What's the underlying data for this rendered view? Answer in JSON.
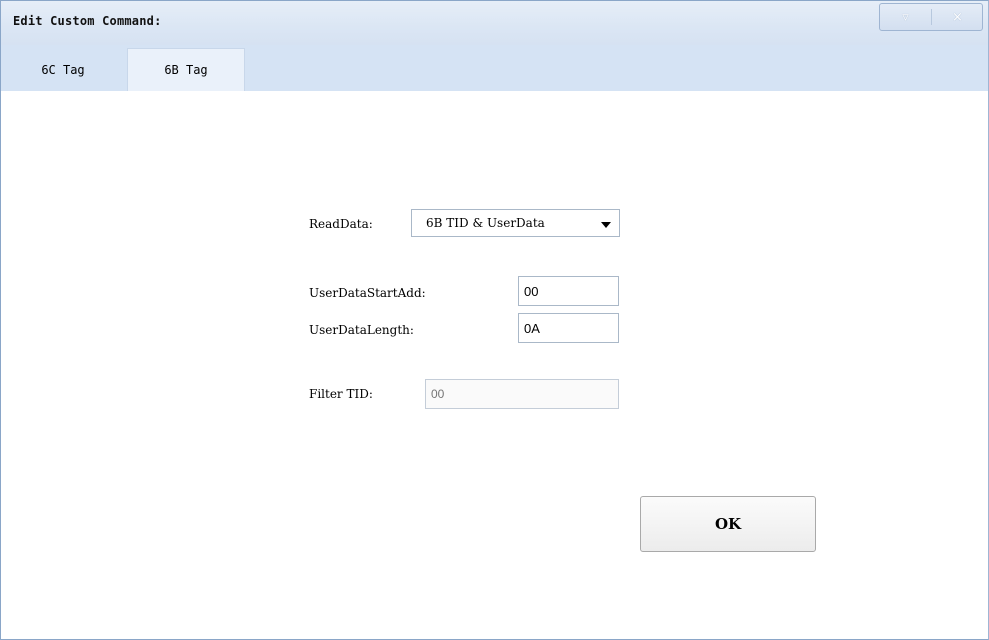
{
  "window": {
    "title": "Edit Custom Command:",
    "controls": {
      "minimize_icon": "▿",
      "close_icon": "×"
    }
  },
  "tabs": [
    {
      "label": "6C Tag",
      "active": false
    },
    {
      "label": "6B Tag",
      "active": true
    }
  ],
  "form": {
    "read_data": {
      "label": "ReadData:",
      "selected": "6B TID & UserData"
    },
    "user_data_start_add": {
      "label": "UserDataStartAdd:",
      "value": "00"
    },
    "user_data_length": {
      "label": "UserDataLength:",
      "value": "0A"
    },
    "filter_tid": {
      "label": "Filter TID:",
      "placeholder": "00",
      "disabled": true
    }
  },
  "buttons": {
    "ok_label": "OK"
  },
  "colors": {
    "titlebar": "#dbe6f4",
    "tabstrip": "#d5e3f4",
    "active_tab": "#eaf1fa",
    "field_border": "#aab8c8"
  }
}
